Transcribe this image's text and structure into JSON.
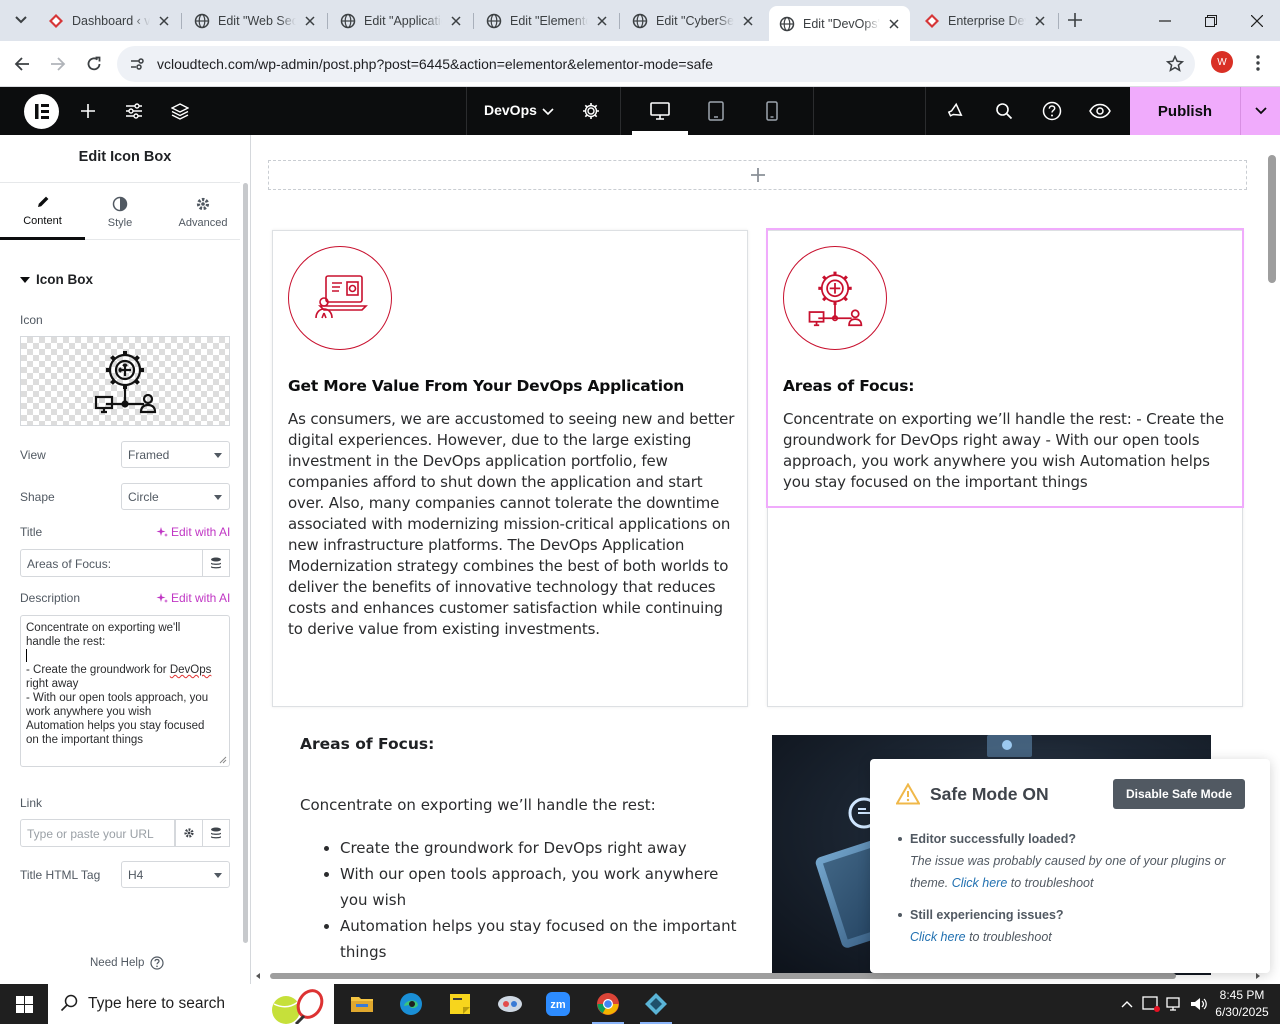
{
  "browser": {
    "tabs": [
      {
        "title": "Dashboard ‹ vcloudtech",
        "favicon": "elementor-red-icon"
      },
      {
        "title": "Edit \"Web Security\"",
        "favicon": "globe-icon"
      },
      {
        "title": "Edit \"Application\"",
        "favicon": "globe-icon"
      },
      {
        "title": "Edit \"Elementor\"",
        "favicon": "globe-icon"
      },
      {
        "title": "Edit \"CyberSecurity\"",
        "favicon": "globe-icon"
      },
      {
        "title": "Edit \"DevOps\"",
        "favicon": "globe-icon",
        "active": true
      },
      {
        "title": "Enterprise DevOps",
        "favicon": "elementor-red-icon"
      }
    ],
    "url": "vcloudtech.com/wp-admin/post.php?post=6445&action=elementor&elementor-mode=safe",
    "profile_initial": "W",
    "profile_color": "#d93025"
  },
  "editor": {
    "document_name": "DevOps",
    "publish_label": "Publish",
    "accent_color": "#f0abfc"
  },
  "panel": {
    "title": "Edit Icon Box",
    "tabs": {
      "content": "Content",
      "style": "Style",
      "advanced": "Advanced"
    },
    "section": "Icon Box",
    "icon_label": "Icon",
    "view_label": "View",
    "view_value": "Framed",
    "shape_label": "Shape",
    "shape_value": "Circle",
    "title_label": "Title",
    "edit_ai": "Edit with AI",
    "title_value": "Areas of Focus:",
    "description_label": "Description",
    "description_lines": {
      "l1": "Concentrate on exporting we'll",
      "l2": "handle the rest:",
      "l3": "- Create the groundwork for ",
      "l3b": "DevOps",
      "l4": "right away",
      "l5": "- With our open tools approach, you",
      "l6": "work anywhere you wish",
      "l7": "Automation helps you stay focused",
      "l8": "on the important things"
    },
    "link_label": "Link",
    "link_placeholder": "Type or paste your URL",
    "html_tag_label": "Title HTML Tag",
    "html_tag_value": "H4",
    "need_help": "Need Help"
  },
  "canvas": {
    "brand_color": "#c8102e",
    "card1": {
      "title": "Get More Value From Your DevOps Application",
      "description": "As consumers, we are accustomed to seeing new and better digital experiences. However, due to the large existing investment in the DevOps application portfolio, few companies afford to shut down the application and start over. Also, many companies cannot tolerate the downtime associated with modernizing mission-critical applications on new infrastructure platforms. The DevOps Application Modernization strategy combines the best of both worlds to deliver the benefits of innovative technology that reduces costs and enhances customer satisfaction while continuing to derive value from existing investments.",
      "icon": "laptop-user-icon"
    },
    "card2": {
      "title": "Areas of Focus:",
      "description": "Concentrate on exporting we’ll handle the rest: - Create the groundwork for DevOps right away - With our open tools approach, you work anywhere you wish Automation helps you stay focused on the important things",
      "icon": "gear-network-icon"
    },
    "lower": {
      "title": "Areas of Focus:",
      "intro": "Concentrate on exporting we’ll handle the rest:",
      "items": [
        "Create the groundwork for DevOps right away",
        "With our open tools approach, you work anywhere you wish",
        "Automation helps you stay focused on the important things"
      ]
    }
  },
  "safe_mode": {
    "title": "Safe Mode ON",
    "disable_label": "Disable Safe Mode",
    "item1_heading": "Editor successfully loaded?",
    "item1_text_a": "The issue was probably caused by one of your plugins or theme.",
    "item1_link": "Click here",
    "item1_text_b": "to troubleshoot",
    "item2_heading": "Still experiencing issues?",
    "item2_link": "Click here",
    "item2_text": "to troubleshoot"
  },
  "taskbar": {
    "search_placeholder": "Type here to search",
    "time": "8:45 PM",
    "date": "6/30/2025"
  }
}
